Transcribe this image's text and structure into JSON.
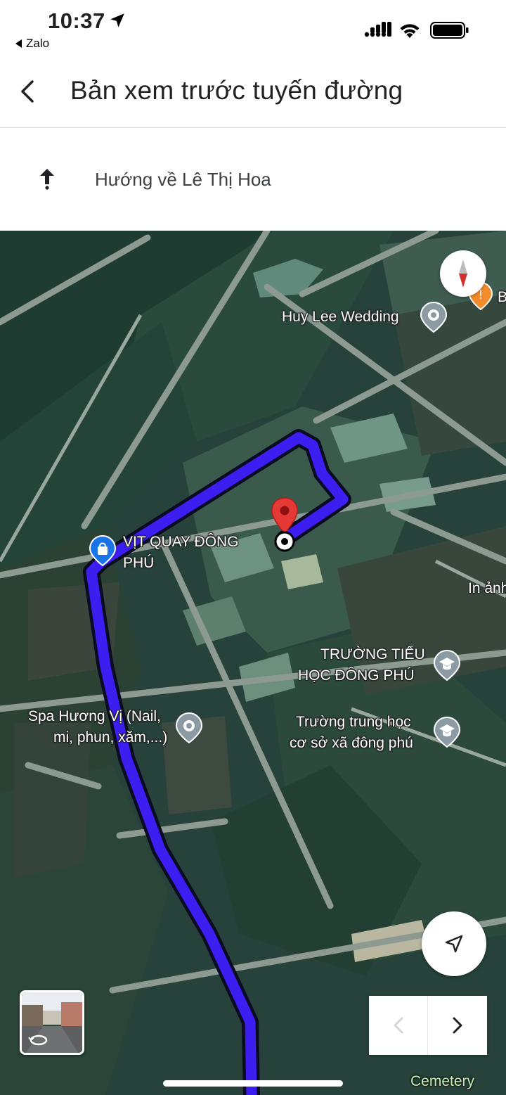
{
  "status_bar": {
    "time": "10:37",
    "back_app": "Zalo",
    "icons": [
      "location-arrow-icon",
      "signal-icon",
      "wifi-icon",
      "battery-icon"
    ]
  },
  "header": {
    "title": "Bản xem trước tuyến đường",
    "back_icon": "chevron-left-icon"
  },
  "step": {
    "icon": "arrow-up-icon",
    "instruction": "Hướng về Lê Thị Hoa"
  },
  "map": {
    "route_color": "#3c1ef0",
    "destination_pin_color": "#e53935",
    "labels": {
      "huy_lee_wedding": "Huy Lee Wedding",
      "partial_right": "B",
      "vit_quay_line1": "VỊT QUAY ĐÔNG",
      "vit_quay_line2": "PHÚ",
      "in_anh": "In ảnh",
      "truong_tieu_hoc_line1": "TRƯỜNG TIỂU",
      "truong_tieu_hoc_line2": "HỌC ĐÔNG PHÚ",
      "spa_line1": "Spa Hương Vị (Nail,",
      "spa_line2": "mi, phun, xăm,...)",
      "truong_thcs_line1": "Trường trung học",
      "truong_thcs_line2": "cơ sở xã đông phú",
      "cemetery": "Cemetery"
    },
    "controls": {
      "compass": "compass-icon",
      "recenter": "navigation-arrow-icon",
      "prev_step": "chevron-left-icon",
      "next_step": "chevron-right-icon",
      "street_view": "street-view-rotate-icon"
    }
  }
}
